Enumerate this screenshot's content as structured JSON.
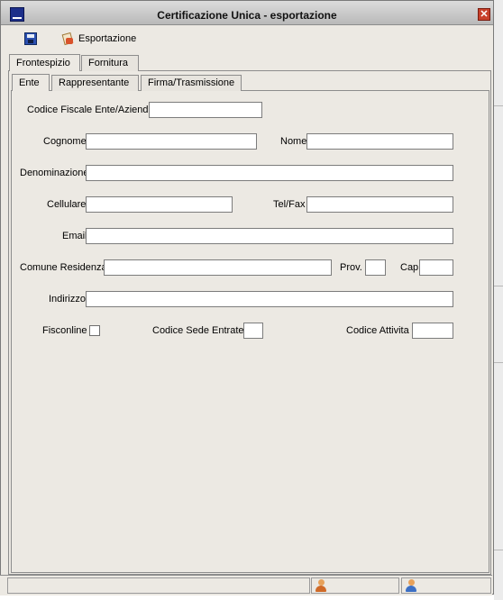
{
  "window": {
    "title": "Certificazione Unica - esportazione",
    "close_glyph": "✕"
  },
  "toolbar": {
    "save_icon": "floppy-disk-icon",
    "export_label": "Esportazione",
    "export_icon": "export-icon"
  },
  "outer_tabs": [
    {
      "label": "Frontespizio",
      "active": true
    },
    {
      "label": "Fornitura",
      "active": false
    }
  ],
  "inner_tabs": [
    {
      "label": "Ente",
      "active": true
    },
    {
      "label": "Rappresentante",
      "active": false
    },
    {
      "label": "Firma/Trasmissione",
      "active": false
    }
  ],
  "form": {
    "codice_fiscale": {
      "label": "Codice Fiscale Ente/Azienda",
      "value": ""
    },
    "cognome": {
      "label": "Cognome",
      "value": ""
    },
    "nome": {
      "label": "Nome",
      "value": ""
    },
    "denominazione": {
      "label": "Denominazione",
      "value": ""
    },
    "cellulare": {
      "label": "Cellulare",
      "value": ""
    },
    "tel_fax": {
      "label": "Tel/Fax",
      "value": ""
    },
    "email": {
      "label": "Email",
      "value": ""
    },
    "comune_residenza": {
      "label": "Comune Residenza",
      "value": ""
    },
    "prov": {
      "label": "Prov.",
      "value": ""
    },
    "cap": {
      "label": "Cap",
      "value": ""
    },
    "indirizzo": {
      "label": "Indirizzo",
      "value": ""
    },
    "fisconline": {
      "label": "Fisconline",
      "checked": false
    },
    "codice_sede_entratel": {
      "label": "Codice Sede Entratel",
      "value": ""
    },
    "codice_attivita": {
      "label": "Codice Attivita",
      "value": ""
    }
  },
  "statusbar": {
    "user_icon": "user-icon",
    "user_info_icon": "user-info-icon"
  },
  "colors": {
    "window_bg": "#ece9e3",
    "titlebar": "#c9c9c9",
    "close_button": "#c8402a"
  }
}
